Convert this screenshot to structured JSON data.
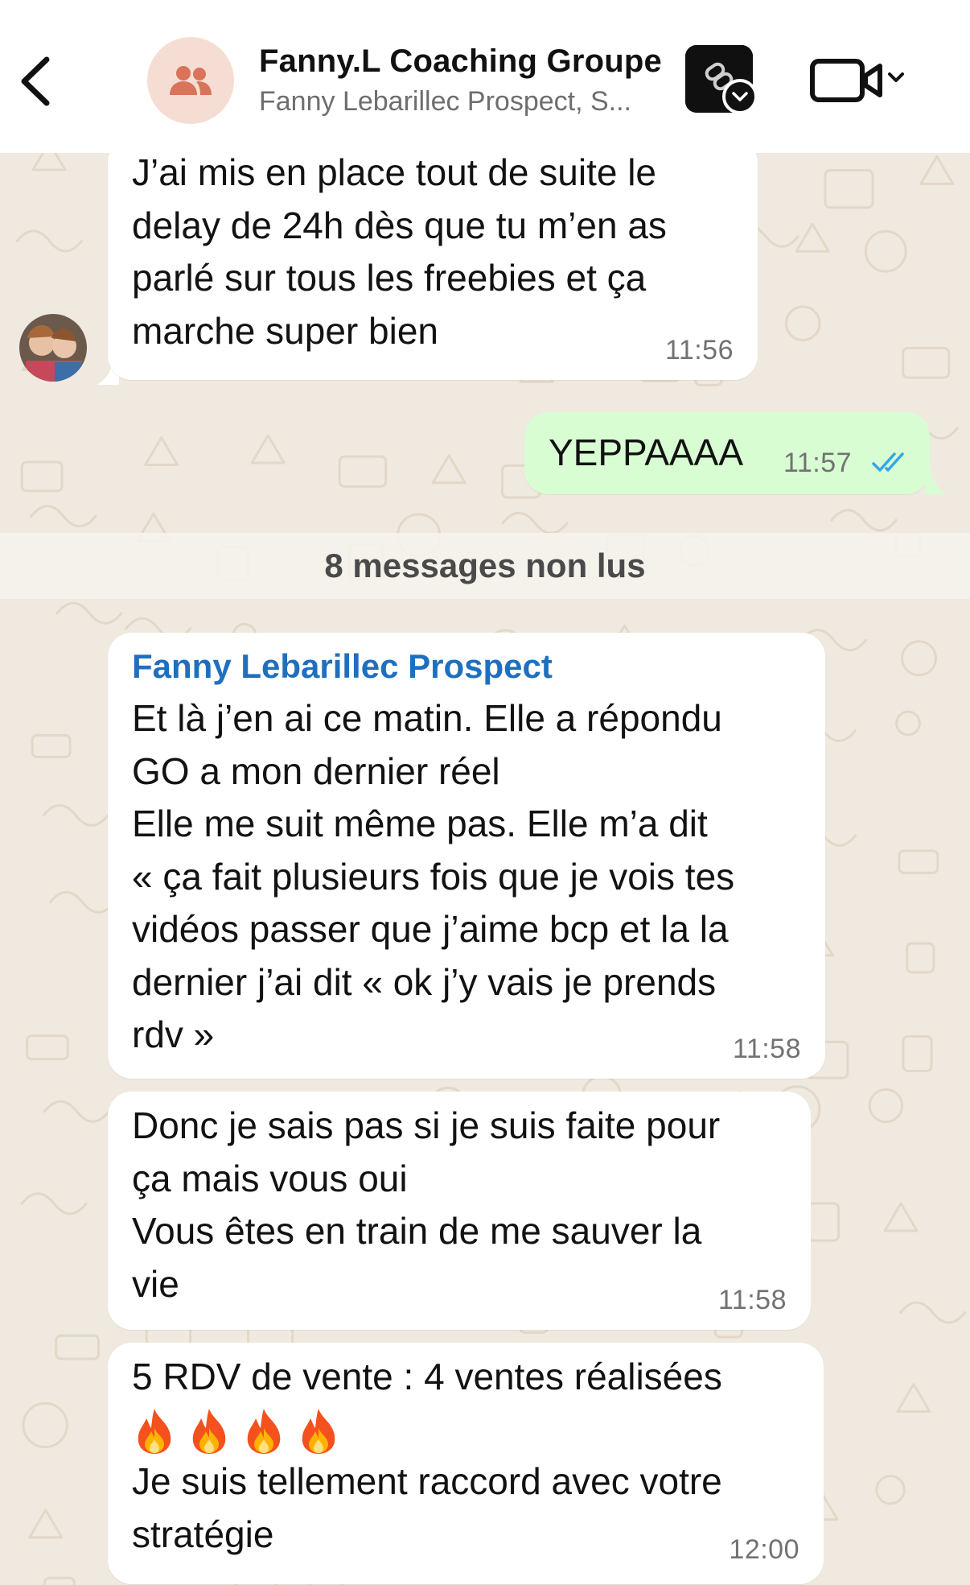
{
  "header": {
    "back_icon": "chevron-left-icon",
    "group_icon": "users-icon",
    "title": "Fanny.L Coaching Groupe",
    "subtitle": "Fanny Lebarillec Prospect, S...",
    "video_icon": "video-camera-icon",
    "dropdown_icon": "chevron-down-icon"
  },
  "messages": [
    {
      "direction": "incoming",
      "text": "J’ai mis en place tout de suite le\ndelay de 24h dès que tu m’en as\nparlé sur tous les freebies et ça\nmarche super bien",
      "time": "11:56"
    },
    {
      "direction": "outgoing",
      "text": "YEPPAAAA",
      "time": "11:57",
      "status_icon": "double-check-read-icon"
    }
  ],
  "unread_banner": "8 messages non lus",
  "unread_messages": [
    {
      "sender": "Fanny Lebarillec Prospect",
      "text": "Et là j’en ai ce matin. Elle a répondu\nGO a mon dernier réel\nElle me suit même pas. Elle m’a dit\n« ça fait plusieurs fois que je vois tes\nvidéos passer que j’aime bcp et la la\ndernier  j’ai dit « ok j’y vais je prends\nrdv »",
      "time": "11:58"
    },
    {
      "text": "Donc je sais pas si je suis faite pour\nça mais vous oui\nVous êtes en train de me sauver la\nvie",
      "time": "11:58"
    },
    {
      "line1": "5 RDV de vente : 4 ventes réalisées",
      "emoji_icons": [
        "fire-icon",
        "fire-icon",
        "fire-icon",
        "fire-icon"
      ],
      "line3": "Je suis tellement raccord avec votre\nstratégie",
      "time": "12:00"
    }
  ],
  "colors": {
    "outgoing_bubble": "#d9fdd3",
    "incoming_bubble": "#ffffff",
    "sender_name": "#1f6fbf",
    "read_ticks": "#34a6e8",
    "wallpaper": "#efe9df"
  }
}
